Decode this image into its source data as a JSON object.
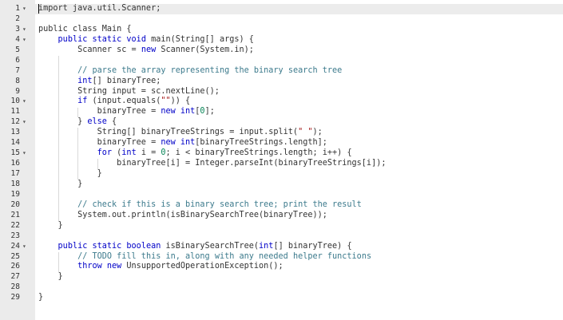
{
  "editor": {
    "lines": [
      {
        "n": "1",
        "fold": "▾",
        "tokens": [
          {
            "t": "import java.util.Scanner;"
          }
        ]
      },
      {
        "n": "2",
        "fold": "",
        "tokens": []
      },
      {
        "n": "3",
        "fold": "▾",
        "tokens": [
          {
            "t": "public class Main {"
          }
        ]
      },
      {
        "n": "4",
        "fold": "▾",
        "tokens": [
          {
            "t": "    "
          },
          {
            "t": "public static void",
            "c": "kw"
          },
          {
            "t": " main(String[] args) {"
          }
        ]
      },
      {
        "n": "5",
        "fold": "",
        "tokens": [
          {
            "t": "        Scanner sc = "
          },
          {
            "t": "new",
            "c": "kw"
          },
          {
            "t": " Scanner(System.in);"
          }
        ]
      },
      {
        "n": "6",
        "fold": "",
        "tokens": []
      },
      {
        "n": "7",
        "fold": "",
        "tokens": [
          {
            "t": "        "
          },
          {
            "t": "// parse the array representing the binary search tree",
            "c": "cm"
          }
        ]
      },
      {
        "n": "8",
        "fold": "",
        "tokens": [
          {
            "t": "        "
          },
          {
            "t": "int",
            "c": "kw"
          },
          {
            "t": "[] binaryTree;"
          }
        ]
      },
      {
        "n": "9",
        "fold": "",
        "tokens": [
          {
            "t": "        String input = sc.nextLine();"
          }
        ]
      },
      {
        "n": "10",
        "fold": "▾",
        "tokens": [
          {
            "t": "        "
          },
          {
            "t": "if",
            "c": "kw"
          },
          {
            "t": " (input.equals("
          },
          {
            "t": "\"\"",
            "c": "st"
          },
          {
            "t": ")) {"
          }
        ]
      },
      {
        "n": "11",
        "fold": "",
        "tokens": [
          {
            "t": "            binaryTree = "
          },
          {
            "t": "new int",
            "c": "kw"
          },
          {
            "t": "["
          },
          {
            "t": "0",
            "c": "nm"
          },
          {
            "t": "];"
          }
        ]
      },
      {
        "n": "12",
        "fold": "▾",
        "tokens": [
          {
            "t": "        } "
          },
          {
            "t": "else",
            "c": "kw"
          },
          {
            "t": " {"
          }
        ]
      },
      {
        "n": "13",
        "fold": "",
        "tokens": [
          {
            "t": "            String[] binaryTreeStrings = input.split("
          },
          {
            "t": "\" \"",
            "c": "st"
          },
          {
            "t": ");"
          }
        ]
      },
      {
        "n": "14",
        "fold": "",
        "tokens": [
          {
            "t": "            binaryTree = "
          },
          {
            "t": "new int",
            "c": "kw"
          },
          {
            "t": "[binaryTreeStrings.length];"
          }
        ]
      },
      {
        "n": "15",
        "fold": "▾",
        "tokens": [
          {
            "t": "            "
          },
          {
            "t": "for",
            "c": "kw"
          },
          {
            "t": " ("
          },
          {
            "t": "int",
            "c": "kw"
          },
          {
            "t": " i = "
          },
          {
            "t": "0",
            "c": "nm"
          },
          {
            "t": "; i < binaryTreeStrings.length; i++) {"
          }
        ]
      },
      {
        "n": "16",
        "fold": "",
        "tokens": [
          {
            "t": "                binaryTree[i] = Integer.parseInt(binaryTreeStrings[i]);"
          }
        ]
      },
      {
        "n": "17",
        "fold": "",
        "tokens": [
          {
            "t": "            }"
          }
        ]
      },
      {
        "n": "18",
        "fold": "",
        "tokens": [
          {
            "t": "        }"
          }
        ]
      },
      {
        "n": "19",
        "fold": "",
        "tokens": []
      },
      {
        "n": "20",
        "fold": "",
        "tokens": [
          {
            "t": "        "
          },
          {
            "t": "// check if this is a binary search tree; print the result",
            "c": "cm"
          }
        ]
      },
      {
        "n": "21",
        "fold": "",
        "tokens": [
          {
            "t": "        System.out.println(isBinarySearchTree(binaryTree));"
          }
        ]
      },
      {
        "n": "22",
        "fold": "",
        "tokens": [
          {
            "t": "    }"
          }
        ]
      },
      {
        "n": "23",
        "fold": "",
        "tokens": []
      },
      {
        "n": "24",
        "fold": "▾",
        "tokens": [
          {
            "t": "    "
          },
          {
            "t": "public static boolean",
            "c": "kw"
          },
          {
            "t": " isBinarySearchTree("
          },
          {
            "t": "int",
            "c": "kw"
          },
          {
            "t": "[] binaryTree) {"
          }
        ]
      },
      {
        "n": "25",
        "fold": "",
        "tokens": [
          {
            "t": "        "
          },
          {
            "t": "// TODO fill this in, along with any needed helper functions",
            "c": "cm"
          }
        ]
      },
      {
        "n": "26",
        "fold": "",
        "tokens": [
          {
            "t": "        "
          },
          {
            "t": "throw new",
            "c": "kw"
          },
          {
            "t": " UnsupportedOperationException();"
          }
        ]
      },
      {
        "n": "27",
        "fold": "",
        "tokens": [
          {
            "t": "    }"
          }
        ]
      },
      {
        "n": "28",
        "fold": "",
        "tokens": []
      },
      {
        "n": "29",
        "fold": "",
        "tokens": [
          {
            "t": "}"
          }
        ]
      }
    ],
    "active_line": 1
  }
}
